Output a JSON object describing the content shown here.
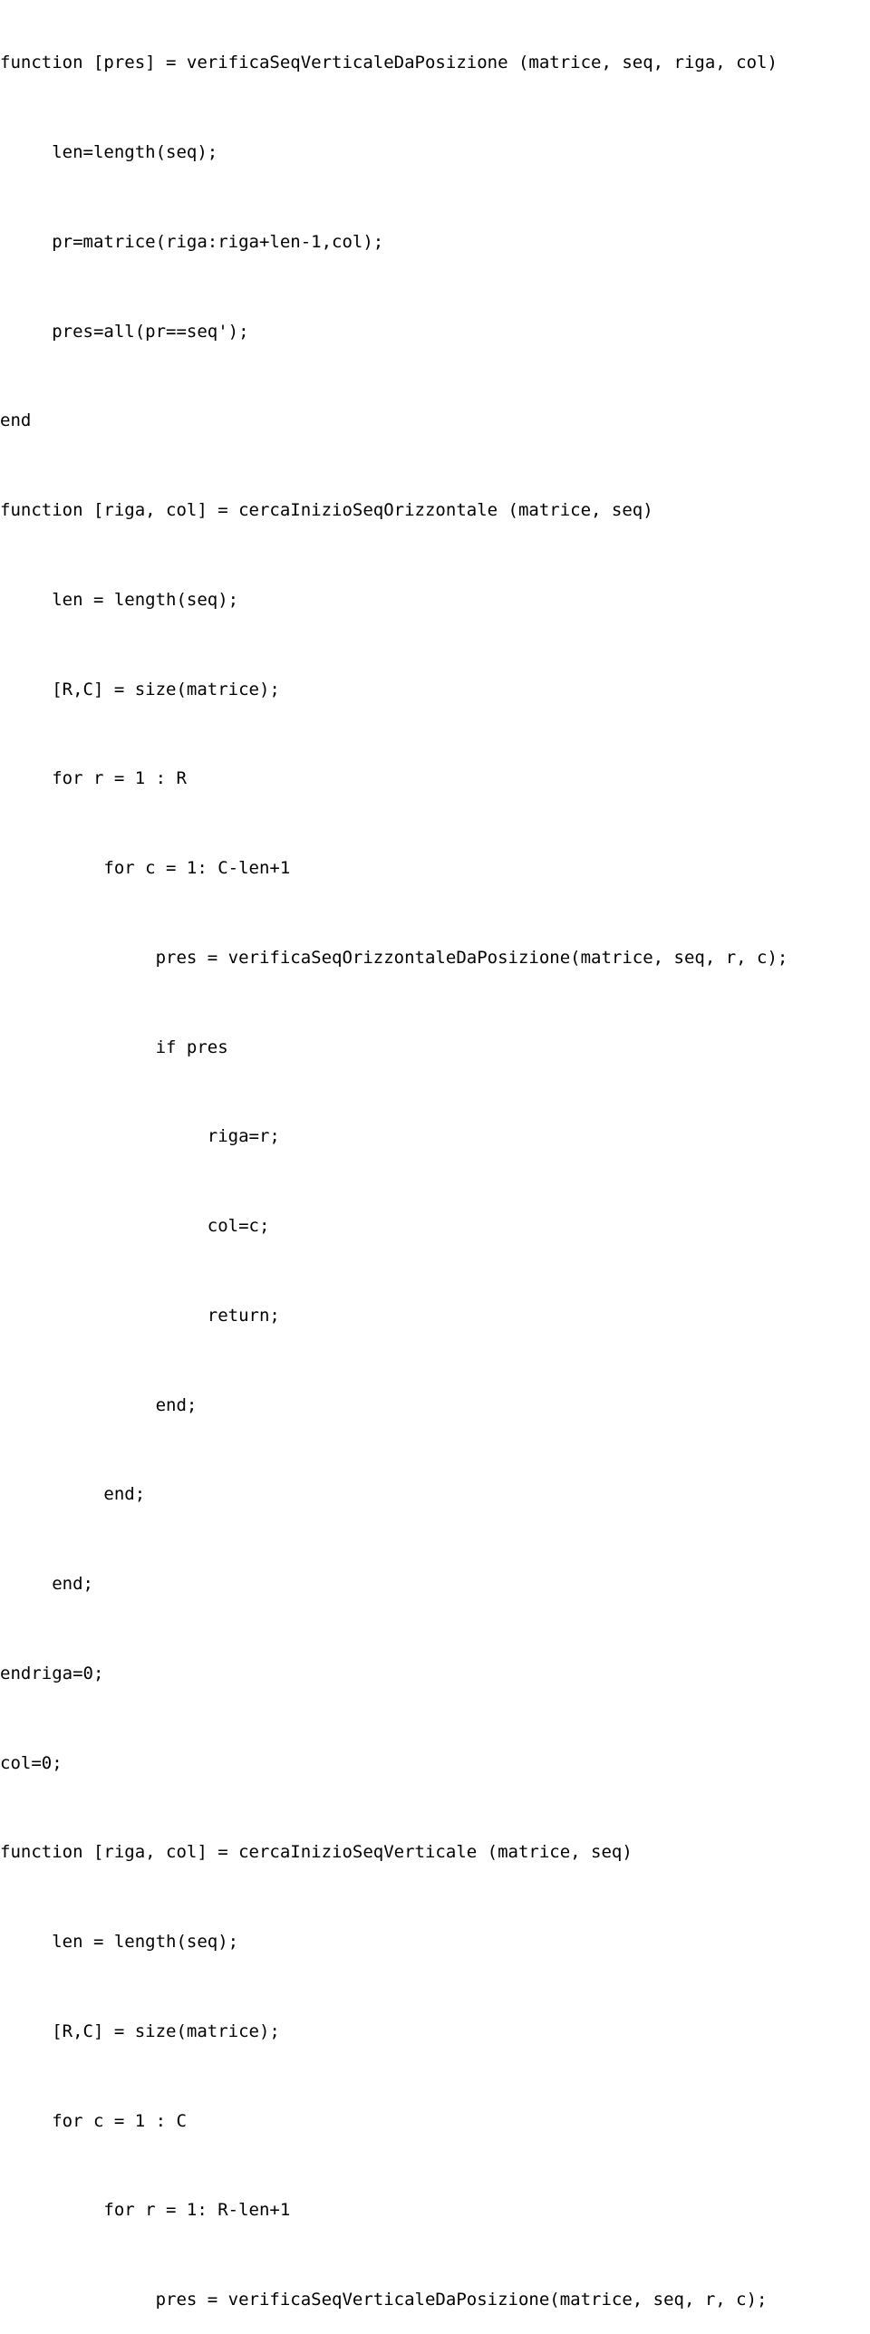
{
  "code": {
    "lines": [
      "function [pres] = verificaSeqVerticaleDaPosizione (matrice, seq, riga, col)",
      "",
      "     len=length(seq);",
      "",
      "     pr=matrice(riga:riga+len-1,col);",
      "",
      "     pres=all(pr==seq');",
      "",
      "end",
      "",
      "function [riga, col] = cercaInizioSeqOrizzontale (matrice, seq)",
      "",
      "     len = length(seq);",
      "",
      "     [R,C] = size(matrice);",
      "",
      "     for r = 1 : R",
      "",
      "          for c = 1: C-len+1",
      "",
      "               pres = verificaSeqOrizzontaleDaPosizione(matrice, seq, r, c);",
      "",
      "               if pres",
      "",
      "                    riga=r;",
      "",
      "                    col=c;",
      "",
      "                    return;",
      "",
      "               end;",
      "",
      "          end;",
      "",
      "     end;",
      "",
      "endriga=0;",
      "",
      "col=0;",
      "",
      "function [riga, col] = cercaInizioSeqVerticale (matrice, seq)",
      "",
      "     len = length(seq);",
      "",
      "     [R,C] = size(matrice);",
      "",
      "     for c = 1 : C",
      "",
      "          for r = 1: R-len+1",
      "",
      "               pres = verificaSeqVerticaleDaPosizione(matrice, seq, r, c);"
    ]
  }
}
